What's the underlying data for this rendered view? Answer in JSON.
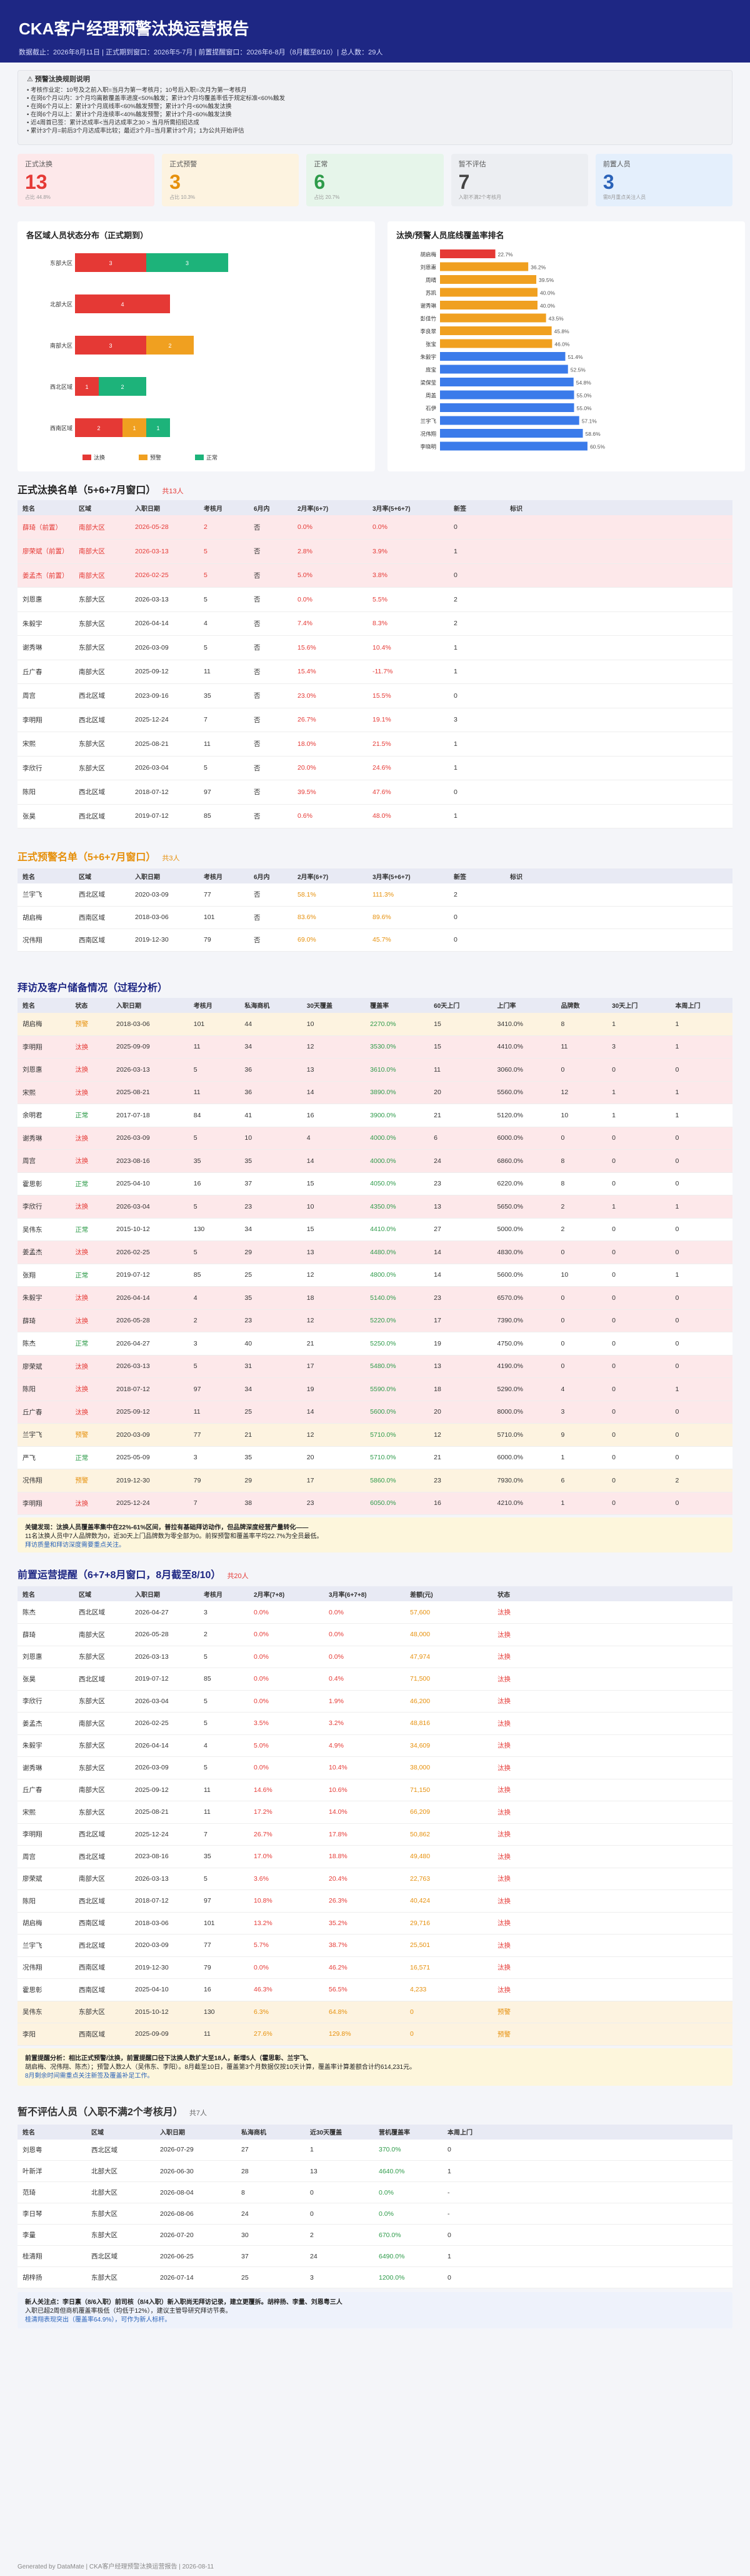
{
  "header": {
    "title": "CKA客户经理预警汰换运营报告",
    "meta": "数据截止：2026年8月11日 | 正式期到窗口：2026年5-7月 | 前置提醒窗口：2026年6-8月（8月截至8/10）| 总人数：29人"
  },
  "rules": {
    "title": "⚠ 预警汰换规则说明",
    "lines": [
      "• 考核作业定：10号及之前入职=当月为第一考核月；10号后入职=次月为第一考核月",
      "• 在岗6个月以内：3个月均离散覆盖率进度<50%触发；累计3个月均覆盖率低于规定标准<60%触发",
      "• 在岗6个月以上：累计3个月底线率<60%触发预警；累计3个月<60%触发汰换",
      "• 在岗6个月以上：累计3个月连续率<40%触发预警；累计3个月<60%触发汰换",
      "• 近4周首已签：累计达成率<当月达成率之30 > 当月所需招招达成",
      "• 累计3个月=前后3个月达成率比较；最近3个月=当月累计3个月；1为公共开始评估"
    ]
  },
  "kpis": [
    {
      "label": "正式汰换",
      "value": "13",
      "sub": "占比 44.8%"
    },
    {
      "label": "正式预警",
      "value": "3",
      "sub": "占比 10.3%"
    },
    {
      "label": "正常",
      "value": "6",
      "sub": "占比 20.7%"
    },
    {
      "label": "暂不评估",
      "value": "7",
      "sub": "入职不满2个考核月"
    },
    {
      "label": "前置人员",
      "value": "3",
      "sub": "需8月重点关注人员"
    }
  ],
  "colors": {
    "red": "#e53935",
    "orange": "#f0a020",
    "green": "#1db37a",
    "blue": "#3b7bea",
    "taotai": "#e53935",
    "yujing": "#f0a020",
    "zhengchang": "#1db37a"
  },
  "chart_data": [
    {
      "type": "bar",
      "title": "各区域人员状态分布（正式期到）",
      "categories": [
        "东部大区",
        "北部大区",
        "南部大区",
        "西北区域",
        "西南区域"
      ],
      "series": [
        {
          "name": "汰换",
          "values": [
            3,
            4,
            3,
            1,
            2
          ]
        },
        {
          "name": "预警",
          "values": [
            0,
            0,
            2,
            0,
            1
          ]
        },
        {
          "name": "正常",
          "values": [
            3,
            0,
            0,
            2,
            1
          ]
        }
      ],
      "legend": [
        "汰换",
        "预警",
        "正常"
      ]
    },
    {
      "type": "bar",
      "title": "汰换/预警人员底线覆盖率排名",
      "categories": [
        "胡启梅",
        "刘恩惠",
        "周晴",
        "苏凯",
        "谢秀琳",
        "彭佳竹",
        "李良翠",
        "张宝",
        "朱毅宇",
        "庞宝",
        "梁保莹",
        "周盖",
        "石伊",
        "兰宇飞",
        "况伟翔",
        "李晓明"
      ],
      "values": [
        22.7,
        36.2,
        39.5,
        40.0,
        40.0,
        43.5,
        45.8,
        46.0,
        51.4,
        52.5,
        54.8,
        55.0,
        55.0,
        57.1,
        58.6,
        60.5
      ],
      "labels": [
        "22.7%",
        "36.2%",
        "39.5%",
        "40.0%",
        "40.0%",
        "43.5%",
        "45.8%",
        "46.0%",
        "51.4%",
        "52.5%",
        "54.8%",
        "55.0%",
        "55.0%",
        "57.1%",
        "58.6%",
        "60.5%"
      ]
    }
  ],
  "sec1": {
    "title": "正式汰换名单（5+6+7月窗口）",
    "count": "共13人",
    "headers": [
      "姓名",
      "区域",
      "入职日期",
      "考核月",
      "6月内",
      "2月率(6+7)",
      "3月率(5+6+7)",
      "新签",
      "标识"
    ],
    "rows": [
      [
        "薛琦（前置）",
        "南部大区",
        "2026-05-28",
        "2",
        "否",
        "0.0%",
        "0.0%",
        "0",
        ""
      ],
      [
        "廖荣斌（前置）",
        "南部大区",
        "2026-03-13",
        "5",
        "否",
        "2.8%",
        "3.9%",
        "1",
        ""
      ],
      [
        "姜孟杰（前置）",
        "南部大区",
        "2026-02-25",
        "5",
        "否",
        "5.0%",
        "3.8%",
        "0",
        ""
      ],
      [
        "刘恩惠",
        "东部大区",
        "2026-03-13",
        "5",
        "否",
        "0.0%",
        "5.5%",
        "2",
        ""
      ],
      [
        "朱毅宇",
        "东部大区",
        "2026-04-14",
        "4",
        "否",
        "7.4%",
        "8.3%",
        "2",
        ""
      ],
      [
        "谢秀琳",
        "东部大区",
        "2026-03-09",
        "5",
        "否",
        "15.6%",
        "10.4%",
        "1",
        ""
      ],
      [
        "丘广春",
        "南部大区",
        "2025-09-12",
        "11",
        "否",
        "15.4%",
        "-11.7%",
        "1",
        ""
      ],
      [
        "周宫",
        "西北区域",
        "2023-09-16",
        "35",
        "否",
        "23.0%",
        "15.5%",
        "0",
        ""
      ],
      [
        "李明翔",
        "西北区域",
        "2025-12-24",
        "7",
        "否",
        "26.7%",
        "19.1%",
        "3",
        ""
      ],
      [
        "宋熙",
        "东部大区",
        "2025-08-21",
        "11",
        "否",
        "18.0%",
        "21.5%",
        "1",
        ""
      ],
      [
        "李欣行",
        "东部大区",
        "2026-03-04",
        "5",
        "否",
        "20.0%",
        "24.6%",
        "1",
        ""
      ],
      [
        "陈阳",
        "西北区域",
        "2018-07-12",
        "97",
        "否",
        "39.5%",
        "47.6%",
        "0",
        ""
      ],
      [
        "张昊",
        "西北区域",
        "2019-07-12",
        "85",
        "否",
        "0.6%",
        "48.0%",
        "1",
        ""
      ]
    ]
  },
  "sec2": {
    "title": "正式预警名单（5+6+7月窗口）",
    "count": "共3人",
    "headers": [
      "姓名",
      "区域",
      "入职日期",
      "考核月",
      "6月内",
      "2月率(6+7)",
      "3月率(5+6+7)",
      "新签",
      "标识"
    ],
    "rows": [
      [
        "兰宇飞",
        "西北区域",
        "2020-03-09",
        "77",
        "否",
        "58.1%",
        "111.3%",
        "2",
        ""
      ],
      [
        "胡启梅",
        "西南区域",
        "2018-03-06",
        "101",
        "否",
        "83.6%",
        "89.6%",
        "0",
        ""
      ],
      [
        "况伟翔",
        "西南区域",
        "2019-12-30",
        "79",
        "否",
        "69.0%",
        "45.7%",
        "0",
        ""
      ]
    ]
  },
  "sec3": {
    "title": "拜访及客户储备情况（过程分析）",
    "headers": [
      "姓名",
      "状态",
      "入职日期",
      "考核月",
      "私海商机",
      "30天覆盖",
      "覆盖率",
      "60天上门",
      "上门率",
      "品牌数",
      "30天上门",
      "本周上门"
    ],
    "rows": [
      [
        "胡启梅",
        "预警",
        "2018-03-06",
        "101",
        "44",
        "10",
        "2270.0%",
        "15",
        "3410.0%",
        "8",
        "1",
        "1"
      ],
      [
        "李明翔",
        "汰换",
        "2025-09-09",
        "11",
        "34",
        "12",
        "3530.0%",
        "15",
        "4410.0%",
        "11",
        "3",
        "1"
      ],
      [
        "刘恩惠",
        "汰换",
        "2026-03-13",
        "5",
        "36",
        "13",
        "3610.0%",
        "11",
        "3060.0%",
        "0",
        "0",
        "0"
      ],
      [
        "宋熙",
        "汰换",
        "2025-08-21",
        "11",
        "36",
        "14",
        "3890.0%",
        "20",
        "5560.0%",
        "12",
        "1",
        "1"
      ],
      [
        "余明君",
        "正常",
        "2017-07-18",
        "84",
        "41",
        "16",
        "3900.0%",
        "21",
        "5120.0%",
        "10",
        "1",
        "1"
      ],
      [
        "谢秀琳",
        "汰换",
        "2026-03-09",
        "5",
        "10",
        "4",
        "4000.0%",
        "6",
        "6000.0%",
        "0",
        "0",
        "0"
      ],
      [
        "周宫",
        "汰换",
        "2023-08-16",
        "35",
        "35",
        "14",
        "4000.0%",
        "24",
        "6860.0%",
        "8",
        "0",
        "0"
      ],
      [
        "霍思彰",
        "正常",
        "2025-04-10",
        "16",
        "37",
        "15",
        "4050.0%",
        "23",
        "6220.0%",
        "8",
        "0",
        "0"
      ],
      [
        "李欣行",
        "汰换",
        "2026-03-04",
        "5",
        "23",
        "10",
        "4350.0%",
        "13",
        "5650.0%",
        "2",
        "1",
        "1"
      ],
      [
        "吴伟东",
        "正常",
        "2015-10-12",
        "130",
        "34",
        "15",
        "4410.0%",
        "27",
        "5000.0%",
        "2",
        "0",
        "0"
      ],
      [
        "姜孟杰",
        "汰换",
        "2026-02-25",
        "5",
        "29",
        "13",
        "4480.0%",
        "14",
        "4830.0%",
        "0",
        "0",
        "0"
      ],
      [
        "张翔",
        "正常",
        "2019-07-12",
        "85",
        "25",
        "12",
        "4800.0%",
        "14",
        "5600.0%",
        "10",
        "0",
        "1"
      ],
      [
        "朱毅宇",
        "汰换",
        "2026-04-14",
        "4",
        "35",
        "18",
        "5140.0%",
        "23",
        "6570.0%",
        "0",
        "0",
        "0"
      ],
      [
        "薛琦",
        "汰换",
        "2026-05-28",
        "2",
        "23",
        "12",
        "5220.0%",
        "17",
        "7390.0%",
        "0",
        "0",
        "0"
      ],
      [
        "陈杰",
        "正常",
        "2026-04-27",
        "3",
        "40",
        "21",
        "5250.0%",
        "19",
        "4750.0%",
        "0",
        "0",
        "0"
      ],
      [
        "廖荣斌",
        "汰换",
        "2026-03-13",
        "5",
        "31",
        "17",
        "5480.0%",
        "13",
        "4190.0%",
        "0",
        "0",
        "0"
      ],
      [
        "陈阳",
        "汰换",
        "2018-07-12",
        "97",
        "34",
        "19",
        "5590.0%",
        "18",
        "5290.0%",
        "4",
        "0",
        "1"
      ],
      [
        "丘广春",
        "汰换",
        "2025-09-12",
        "11",
        "25",
        "14",
        "5600.0%",
        "20",
        "8000.0%",
        "3",
        "0",
        "0"
      ],
      [
        "兰宇飞",
        "预警",
        "2020-03-09",
        "77",
        "21",
        "12",
        "5710.0%",
        "12",
        "5710.0%",
        "9",
        "0",
        "0"
      ],
      [
        "严飞",
        "正常",
        "2025-05-09",
        "3",
        "35",
        "20",
        "5710.0%",
        "21",
        "6000.0%",
        "1",
        "0",
        "0"
      ],
      [
        "况伟翔",
        "预警",
        "2019-12-30",
        "79",
        "29",
        "17",
        "5860.0%",
        "23",
        "7930.0%",
        "6",
        "0",
        "2"
      ],
      [
        "李明翔",
        "汰换",
        "2025-12-24",
        "7",
        "38",
        "23",
        "6050.0%",
        "16",
        "4210.0%",
        "1",
        "0",
        "0"
      ]
    ]
  },
  "note3": {
    "title": "关键发现：汰换人员覆盖率集中在22%-61%区间，普拉有基础拜访动作，但品牌深度经营产量转化——",
    "l2": "11名汰换人员中7人品牌数为0，近30天上门品牌数为零全部为0。前探预警和覆盖率平均22.7%为全员最低。",
    "l3": "拜访质量和拜访深度需要重点关注。"
  },
  "sec4": {
    "title": "前置运营提醒（6+7+8月窗口，8月截至8/10）",
    "count": "共20人",
    "headers": [
      "姓名",
      "区域",
      "入职日期",
      "考核月",
      "2月率(7+8)",
      "3月率(6+7+8)",
      "差额(元)",
      "状态"
    ],
    "rows": [
      [
        "陈杰",
        "西北区域",
        "2026-04-27",
        "3",
        "0.0%",
        "0.0%",
        "57,600",
        "汰换"
      ],
      [
        "薛琦",
        "南部大区",
        "2026-05-28",
        "2",
        "0.0%",
        "0.0%",
        "48,000",
        "汰换"
      ],
      [
        "刘恩惠",
        "东部大区",
        "2026-03-13",
        "5",
        "0.0%",
        "0.0%",
        "47,974",
        "汰换"
      ],
      [
        "张昊",
        "西北区域",
        "2019-07-12",
        "85",
        "0.0%",
        "0.4%",
        "71,500",
        "汰换"
      ],
      [
        "李欣行",
        "东部大区",
        "2026-03-04",
        "5",
        "0.0%",
        "1.9%",
        "46,200",
        "汰换"
      ],
      [
        "姜孟杰",
        "南部大区",
        "2026-02-25",
        "5",
        "3.5%",
        "3.2%",
        "48,816",
        "汰换"
      ],
      [
        "朱毅宇",
        "东部大区",
        "2026-04-14",
        "4",
        "5.0%",
        "4.9%",
        "34,609",
        "汰换"
      ],
      [
        "谢秀琳",
        "东部大区",
        "2026-03-09",
        "5",
        "0.0%",
        "10.4%",
        "38,000",
        "汰换"
      ],
      [
        "丘广春",
        "南部大区",
        "2025-09-12",
        "11",
        "14.6%",
        "10.6%",
        "71,150",
        "汰换"
      ],
      [
        "宋熙",
        "东部大区",
        "2025-08-21",
        "11",
        "17.2%",
        "14.0%",
        "66,209",
        "汰换"
      ],
      [
        "李明翔",
        "西北区域",
        "2025-12-24",
        "7",
        "26.7%",
        "17.8%",
        "50,862",
        "汰换"
      ],
      [
        "周宫",
        "西北区域",
        "2023-08-16",
        "35",
        "17.0%",
        "18.8%",
        "49,480",
        "汰换"
      ],
      [
        "廖荣斌",
        "南部大区",
        "2026-03-13",
        "5",
        "3.6%",
        "20.4%",
        "22,763",
        "汰换"
      ],
      [
        "陈阳",
        "西北区域",
        "2018-07-12",
        "97",
        "10.8%",
        "26.3%",
        "40,424",
        "汰换"
      ],
      [
        "胡启梅",
        "西南区域",
        "2018-03-06",
        "101",
        "13.2%",
        "35.2%",
        "29,716",
        "汰换"
      ],
      [
        "兰宇飞",
        "西北区域",
        "2020-03-09",
        "77",
        "5.7%",
        "38.7%",
        "25,501",
        "汰换"
      ],
      [
        "况伟翔",
        "西南区域",
        "2019-12-30",
        "79",
        "0.0%",
        "46.2%",
        "16,571",
        "汰换"
      ],
      [
        "霍思彰",
        "西南区域",
        "2025-04-10",
        "16",
        "46.3%",
        "56.5%",
        "4,233",
        "汰换"
      ],
      [
        "吴伟东",
        "东部大区",
        "2015-10-12",
        "130",
        "6.3%",
        "64.8%",
        "0",
        "预警"
      ],
      [
        "李阳",
        "西南区域",
        "2025-09-09",
        "11",
        "27.6%",
        "129.8%",
        "0",
        "预警"
      ]
    ]
  },
  "note4": {
    "l1": "前置提醒分析：相比正式预警/汰换，前置提醒口径下汰换人数扩大至18人，新增5人（霍思彰、兰宇飞、",
    "l2": "胡启梅、况伟翔、陈杰）；预警人数2人（吴伟东、李阳）。8月截至10日，覆盖第3个月数据仅按10天计算，覆盖率计算差额合计约614,231元。",
    "l3": "8月剩余时间需重点关注新签及覆盖补足工作。"
  },
  "sec5": {
    "title": "暂不评估人员（入职不满2个考核月）",
    "count": "共7人",
    "headers": [
      "姓名",
      "区域",
      "入职日期",
      "私海商机",
      "近30天覆盖",
      "营机覆盖率",
      "本周上门"
    ],
    "rows": [
      [
        "刘恩粤",
        "西北区域",
        "2026-07-29",
        "27",
        "1",
        "370.0%",
        "0"
      ],
      [
        "叶新洋",
        "北部大区",
        "2026-06-30",
        "28",
        "13",
        "4640.0%",
        "1"
      ],
      [
        "范琦",
        "北部大区",
        "2026-08-04",
        "8",
        "0",
        "0.0%",
        "-"
      ],
      [
        "李日琴",
        "东部大区",
        "2026-08-06",
        "24",
        "0",
        "0.0%",
        "-"
      ],
      [
        "李量",
        "东部大区",
        "2026-07-20",
        "30",
        "2",
        "670.0%",
        "0"
      ],
      [
        "桂清翔",
        "西北区域",
        "2026-06-25",
        "37",
        "24",
        "6490.0%",
        "1"
      ],
      [
        "胡梓扬",
        "东部大区",
        "2026-07-14",
        "25",
        "3",
        "1200.0%",
        "0"
      ]
    ]
  },
  "note5": {
    "l1": "新人关注点：李日禀（8/6入职）前司核（8/4入职）新入职尚无拜访记录，建立更覆拆。胡梓扬、李量、刘恩粤三人",
    "l2": "入职已超2周但商机覆盖率极低（均低于12%），建议主管导研究拜访节奏。",
    "l3": "桂清翔表现突出（覆盖率64.9%），可作为新人标杆。"
  },
  "footer": "Generated by DataMate | CKA客户经理预警汰换运营报告 | 2026-08-11"
}
